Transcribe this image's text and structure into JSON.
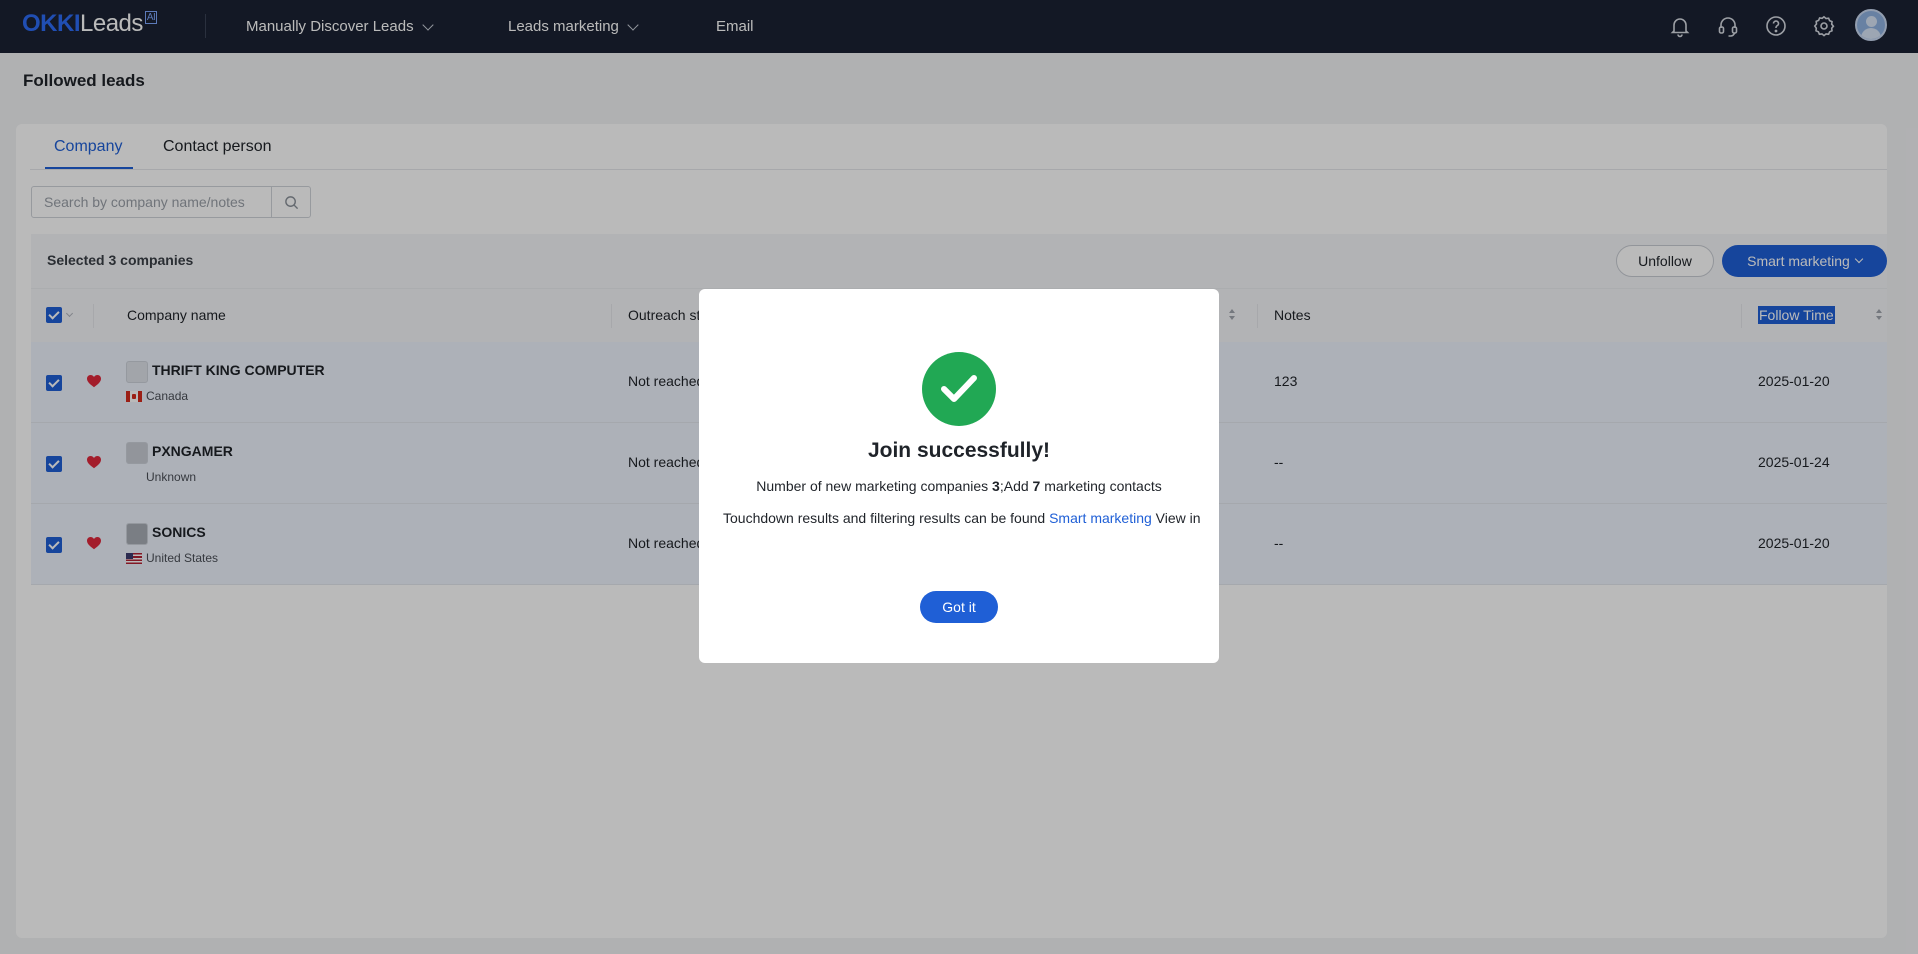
{
  "app": {
    "logo_okki": "OKKI",
    "logo_leads": "Leads",
    "logo_badge": "AI"
  },
  "nav": {
    "items": [
      {
        "label": "Manually Discover Leads",
        "has_dropdown": true
      },
      {
        "label": "Leads marketing",
        "has_dropdown": true
      },
      {
        "label": "Email",
        "has_dropdown": false
      }
    ],
    "icons": [
      "bell-icon",
      "headset-icon",
      "help-icon",
      "settings-icon"
    ]
  },
  "page": {
    "title": "Followed leads"
  },
  "tabs": [
    {
      "label": "Company",
      "active": true
    },
    {
      "label": "Contact person",
      "active": false
    }
  ],
  "search": {
    "placeholder": "Search by company name/notes",
    "value": ""
  },
  "selection": {
    "text": "Selected 3 companies",
    "unfollow_label": "Unfollow",
    "smart_marketing_label": "Smart marketing"
  },
  "table": {
    "columns": [
      "Company name",
      "Outreach sta",
      "Notes",
      "Follow Time"
    ],
    "rows": [
      {
        "name": "THRIFT KING COMPUTER",
        "country": "Canada",
        "outreach": "Not reached",
        "notes": "123",
        "follow_time": "2025-01-20"
      },
      {
        "name": "PXNGAMER",
        "country": "Unknown",
        "outreach": "Not reached",
        "notes": "--",
        "follow_time": "2025-01-24"
      },
      {
        "name": "SONICS",
        "country": "United States",
        "outreach": "Not reached",
        "notes": "--",
        "follow_time": "2025-01-20"
      }
    ]
  },
  "modal": {
    "title": "Join successfully!",
    "line1_prefix": "Number of new marketing companies ",
    "companies_count": "3",
    "line1_mid": ";Add ",
    "contacts_count": "7",
    "line1_suffix": " marketing contacts",
    "line2_prefix": "Touchdown results and filtering results can be found ",
    "line2_link": "Smart marketing",
    "line2_suffix": " View in",
    "button_label": "Got it"
  },
  "colors": {
    "topbar": "#1b2233",
    "primary": "#1f5fd6",
    "success": "#21a854",
    "heart": "#e0283c"
  }
}
